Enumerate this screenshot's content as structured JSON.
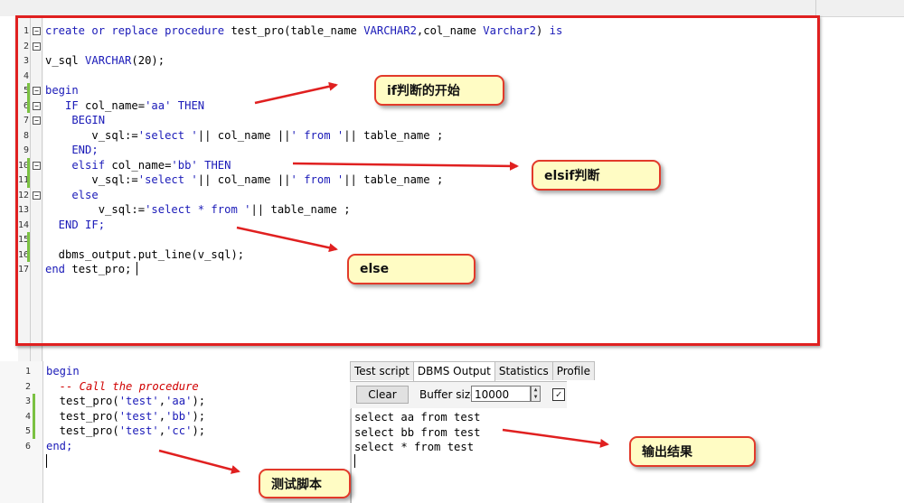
{
  "editor": {
    "line_numbers": [
      "1",
      "2",
      "3",
      "4",
      "5",
      "6",
      "7",
      "8",
      "9",
      "10",
      "11",
      "12",
      "13",
      "14",
      "15",
      "16",
      "17"
    ],
    "lines": [
      [
        {
          "t": "create or replace procedure ",
          "c": "kw"
        },
        {
          "t": "test_pro(table_name ",
          "c": "plain"
        },
        {
          "t": "VARCHAR2",
          "c": "kw"
        },
        {
          "t": ",col_name ",
          "c": "plain"
        },
        {
          "t": "Varchar2",
          "c": "kw"
        },
        {
          "t": ") ",
          "c": "plain"
        },
        {
          "t": "is",
          "c": "kw"
        }
      ],
      [],
      [
        {
          "t": "v_sql ",
          "c": "plain"
        },
        {
          "t": "VARCHAR",
          "c": "kw"
        },
        {
          "t": "(20);",
          "c": "plain"
        }
      ],
      [],
      [
        {
          "t": "begin",
          "c": "kw"
        }
      ],
      [
        {
          "t": "   IF ",
          "c": "kw"
        },
        {
          "t": "col_name=",
          "c": "plain"
        },
        {
          "t": "'aa'",
          "c": "str"
        },
        {
          "t": " THEN",
          "c": "kw"
        }
      ],
      [
        {
          "t": "    BEGIN",
          "c": "kw"
        }
      ],
      [
        {
          "t": "       v_sql:=",
          "c": "plain"
        },
        {
          "t": "'select '",
          "c": "str"
        },
        {
          "t": "|| col_name ||",
          "c": "plain"
        },
        {
          "t": "' from '",
          "c": "str"
        },
        {
          "t": "|| table_name ;",
          "c": "plain"
        }
      ],
      [
        {
          "t": "    END;",
          "c": "kw"
        }
      ],
      [
        {
          "t": "    elsif ",
          "c": "kw"
        },
        {
          "t": "col_name=",
          "c": "plain"
        },
        {
          "t": "'bb'",
          "c": "str"
        },
        {
          "t": " THEN",
          "c": "kw"
        }
      ],
      [
        {
          "t": "       v_sql:=",
          "c": "plain"
        },
        {
          "t": "'select '",
          "c": "str"
        },
        {
          "t": "|| col_name ||",
          "c": "plain"
        },
        {
          "t": "' from '",
          "c": "str"
        },
        {
          "t": "|| table_name ;",
          "c": "plain"
        }
      ],
      [
        {
          "t": "    else",
          "c": "kw"
        }
      ],
      [
        {
          "t": "        v_sql:=",
          "c": "plain"
        },
        {
          "t": "'select * from '",
          "c": "str"
        },
        {
          "t": "|| table_name ;",
          "c": "plain"
        }
      ],
      [
        {
          "t": "  END IF;",
          "c": "kw"
        }
      ],
      [],
      [
        {
          "t": "  dbms_output.put_line(v_sql);",
          "c": "plain"
        }
      ],
      [
        {
          "t": "end ",
          "c": "kw"
        },
        {
          "t": "test_pro;",
          "c": "plain"
        }
      ]
    ]
  },
  "test_script": {
    "line_numbers": [
      "1",
      "2",
      "3",
      "4",
      "5",
      "6"
    ],
    "lines": [
      [
        {
          "t": "begin",
          "c": "kw"
        }
      ],
      [
        {
          "t": "  -- Call the procedure",
          "c": "cm"
        }
      ],
      [
        {
          "t": "  test_pro(",
          "c": "plain"
        },
        {
          "t": "'test'",
          "c": "str"
        },
        {
          "t": ",",
          "c": "plain"
        },
        {
          "t": "'aa'",
          "c": "str"
        },
        {
          "t": ");",
          "c": "plain"
        }
      ],
      [
        {
          "t": "  test_pro(",
          "c": "plain"
        },
        {
          "t": "'test'",
          "c": "str"
        },
        {
          "t": ",",
          "c": "plain"
        },
        {
          "t": "'bb'",
          "c": "str"
        },
        {
          "t": ");",
          "c": "plain"
        }
      ],
      [
        {
          "t": "  test_pro(",
          "c": "plain"
        },
        {
          "t": "'test'",
          "c": "str"
        },
        {
          "t": ",",
          "c": "plain"
        },
        {
          "t": "'cc'",
          "c": "str"
        },
        {
          "t": ");",
          "c": "plain"
        }
      ],
      [
        {
          "t": "end;",
          "c": "kw"
        }
      ]
    ]
  },
  "output_panel": {
    "tabs": [
      "Test script",
      "DBMS Output",
      "Statistics",
      "Profile"
    ],
    "active_tab": "DBMS Output",
    "clear_label": "Clear",
    "buffer_size_label": "Buffer size",
    "buffer_size_value": "10000",
    "checkbox_checked": true,
    "lines": [
      "select aa from test",
      "select bb from test",
      "select * from test"
    ]
  },
  "annotations": {
    "if_start": "if判断的开始",
    "elsif": "elsif判断",
    "else": "else",
    "test_script": "测试脚本",
    "output_result": "输出结果"
  },
  "colors": {
    "keyword": "#1a1ab8",
    "comment": "#d00000",
    "frame": "#e02020",
    "callout_bg": "#fffcc4"
  }
}
